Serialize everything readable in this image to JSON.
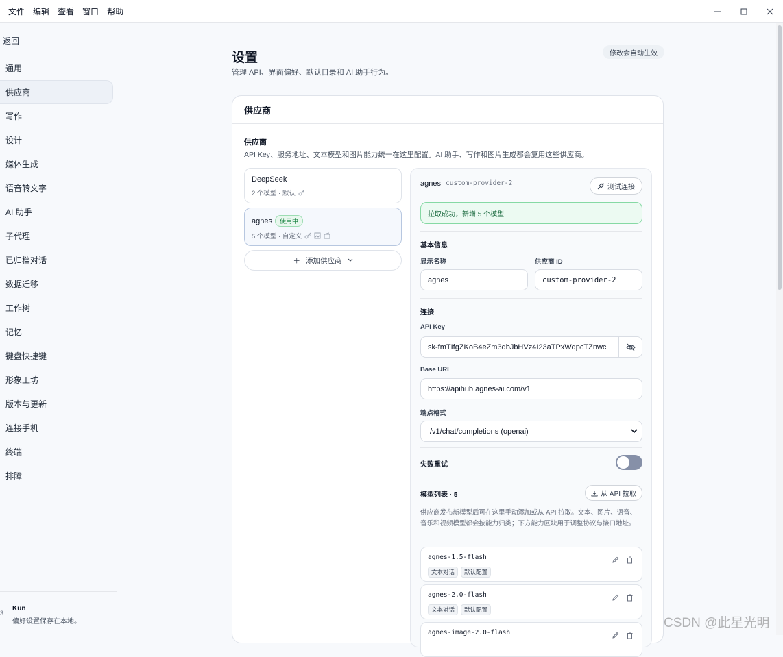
{
  "menu": [
    "文件",
    "编辑",
    "查看",
    "窗口",
    "帮助"
  ],
  "window_controls": {
    "minimize": "—",
    "maximize": "☐",
    "close": "✕"
  },
  "sidebar": {
    "back": "返回",
    "items": [
      {
        "label": "通用"
      },
      {
        "label": "供应商",
        "active": true
      },
      {
        "label": "写作"
      },
      {
        "label": "设计"
      },
      {
        "label": "媒体生成"
      },
      {
        "label": "语音转文字"
      },
      {
        "label": "AI 助手"
      },
      {
        "label": "子代理"
      },
      {
        "label": "已归档对话"
      },
      {
        "label": "数据迁移"
      },
      {
        "label": "工作树"
      },
      {
        "label": "记忆"
      },
      {
        "label": "键盘快捷键"
      },
      {
        "label": "形象工坊"
      },
      {
        "label": "版本与更新"
      },
      {
        "label": "连接手机"
      },
      {
        "label": "终端"
      },
      {
        "label": "排障"
      }
    ],
    "footer": {
      "num": "3",
      "name": "Kun",
      "sub": "偏好设置保存在本地。"
    }
  },
  "header": {
    "title": "设置",
    "subtitle": "管理 API、界面偏好、默认目录和 AI 助手行为。",
    "autosave": "修改会自动生效"
  },
  "card": {
    "title": "供应商",
    "section_title": "供应商",
    "section_desc": "API Key、服务地址、文本模型和图片能力统一在这里配置。AI 助手、写作和图片生成都会复用这些供应商。",
    "providers": [
      {
        "name": "DeepSeek",
        "meta": "2 个模型 · 默认"
      },
      {
        "name": "agnes",
        "badge": "使用中",
        "meta": "5 个模型 · 自定义"
      }
    ],
    "add_provider": "添加供应商"
  },
  "detail": {
    "name": "agnes",
    "id": "custom-provider-2",
    "test_button": "测试连接",
    "success": "拉取成功，新增 5 个模型",
    "basic_info": "基本信息",
    "display_name_label": "显示名称",
    "display_name_value": "agnes",
    "provider_id_label": "供应商 ID",
    "provider_id_value": "custom-provider-2",
    "connection": "连接",
    "api_key_label": "API Key",
    "api_key_value": "sk-fmTIfgZKoB4eZm3dbJbHVz4I23aTPxWqpcTZnwc",
    "base_url_label": "Base URL",
    "base_url_value": "https://apihub.agnes-ai.com/v1",
    "endpoint_label": "端点格式",
    "endpoint_value": "/v1/chat/completions (openai)",
    "retry_label": "失败重试",
    "retry_enabled": false,
    "model_list_label": "模型列表 · 5",
    "fetch_button": "从 API 拉取",
    "model_desc": "供应商发布新模型后可在这里手动添加或从 API 拉取。文本、图片、语音、音乐和视频模型都会按能力归类；下方能力区块用于调整协议与接口地址。",
    "models": [
      {
        "name": "agnes-1.5-flash",
        "tags": [
          "文本对话",
          "默认配置"
        ]
      },
      {
        "name": "agnes-2.0-flash",
        "tags": [
          "文本对话",
          "默认配置"
        ]
      },
      {
        "name": "agnes-image-2.0-flash",
        "tags": []
      }
    ]
  },
  "watermark": "CSDN @此星光明"
}
